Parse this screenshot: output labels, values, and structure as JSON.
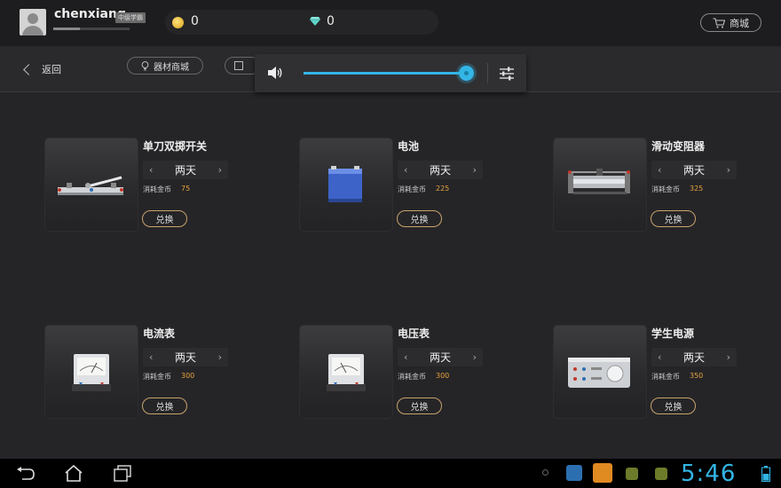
{
  "user": {
    "name": "chenxiang",
    "badge": "中级学霸",
    "xp_progress": 0.35
  },
  "currency": {
    "coins": "0",
    "gems": "0"
  },
  "header": {
    "shop_label": "商城"
  },
  "nav": {
    "back_label": "返回",
    "equip_tab_label": "器材商城"
  },
  "volume": {
    "level": 1.0
  },
  "items": [
    {
      "name": "单刀双掷开关",
      "duration": "两天",
      "cost_label": "消耗金币",
      "cost": "75",
      "redeem_label": "兑换",
      "icon": "knife-switch-icon"
    },
    {
      "name": "电池",
      "duration": "两天",
      "cost_label": "消耗金币",
      "cost": "225",
      "redeem_label": "兑换",
      "icon": "battery-icon"
    },
    {
      "name": "滑动变阻器",
      "duration": "两天",
      "cost_label": "消耗金币",
      "cost": "325",
      "redeem_label": "兑换",
      "icon": "rheostat-icon"
    },
    {
      "name": "电流表",
      "duration": "两天",
      "cost_label": "消耗金币",
      "cost": "300",
      "redeem_label": "兑换",
      "icon": "ammeter-icon"
    },
    {
      "name": "电压表",
      "duration": "两天",
      "cost_label": "消耗金币",
      "cost": "300",
      "redeem_label": "兑换",
      "icon": "voltmeter-icon"
    },
    {
      "name": "学生电源",
      "duration": "两天",
      "cost_label": "消耗金币",
      "cost": "350",
      "redeem_label": "兑换",
      "icon": "power-supply-icon"
    }
  ],
  "duration_arrows": {
    "prev": "‹",
    "next": "›"
  },
  "system": {
    "time": "5:46"
  },
  "colors": {
    "accent": "#33b5e5",
    "cost": "#e8a23a",
    "redeem_border": "#c9a36b"
  }
}
